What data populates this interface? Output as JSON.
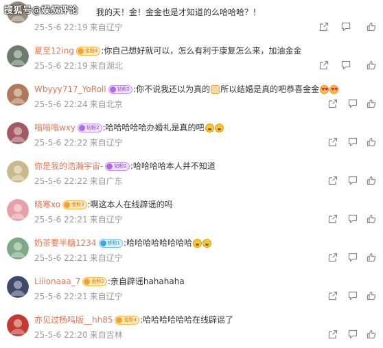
{
  "watermark": "搜狐号@娱叔评论",
  "comments": [
    {
      "username": "",
      "badge": "",
      "text": "我的天！金！金金也是才知道的么哈哈哈？！",
      "emojis": [],
      "date": "25-5-6 22:19",
      "source": "来自辽宁",
      "avatar_color": "#9c8a7a"
    },
    {
      "username": "夏至12ing",
      "badge": "金粉4",
      "badge_style": "orange",
      "text": ":你自己想好就可以，怎么有利于康复怎么来，加油金金",
      "emojis": [],
      "date": "25-5-6 22:19",
      "source": "来自湖北",
      "avatar_color": "#6b7d6a"
    },
    {
      "username": "Wbyyy717_YoRoll",
      "badge": "钻粉2",
      "badge_style": "purple",
      "text": ":你不说我还以为真的",
      "text2": "所以结婚是真的吧恭喜金金",
      "emojis": [
        "cake",
        "love",
        "love"
      ],
      "date": "25-5-6 22:24",
      "source": "来自北京",
      "avatar_color": "#b07a5a"
    },
    {
      "username": "嗡嗡嗡wxy",
      "badge": "钻粉2",
      "badge_style": "purple",
      "text": ":哈哈哈哈哈办婚礼是真的吧",
      "emojis": [
        "laugh",
        "laugh"
      ],
      "date": "25-5-6 22:22",
      "source": "来自辽宁",
      "avatar_color": "#a35a62"
    },
    {
      "username": "你是我的浩瀚宇宙-",
      "badge": "钻粉2",
      "badge_style": "purple",
      "text": ":哈哈哈哈本人并不知道",
      "emojis": [],
      "date": "25-5-6 22:22",
      "source": "来自广东",
      "avatar_color": "#c9b98a"
    },
    {
      "username": "晓寒xo",
      "badge": "金粉3",
      "badge_style": "orange",
      "text": ":啊这本人在线辟谣的吗",
      "emojis": [],
      "date": "25-5-6 22:21",
      "source": "来自辽宁",
      "avatar_color": "#e6a0a8"
    },
    {
      "username": "奶茶要半糖1234",
      "badge": "铁粉1",
      "badge_style": "teal",
      "text": ":哈哈哈哈哈哈哈哈",
      "emojis": [
        "laugh",
        "laugh"
      ],
      "date": "25-5-6 22:21",
      "source": "来自辽宁",
      "avatar_color": "#7fa885"
    },
    {
      "username": "Liiionaaa_7",
      "badge": "金粉2",
      "badge_style": "orange",
      "text": ":亲自辟谣hahahaha",
      "emojis": [],
      "date": "25-5-6 22:21",
      "source": "来自辽宁",
      "avatar_color": "#3d4a6b"
    },
    {
      "username": "亦见过杨鸣版__hh85",
      "badge": "金粉4",
      "badge_style": "orange",
      "text": ":哈哈哈哈哈哈在线辟谣了",
      "emojis": [],
      "date": "25-5-6 22:20",
      "source": "来自吉林",
      "avatar_color": "#c43a32"
    }
  ],
  "icons": {
    "share": "share-icon",
    "comment": "comment-icon",
    "like": "like-icon"
  }
}
